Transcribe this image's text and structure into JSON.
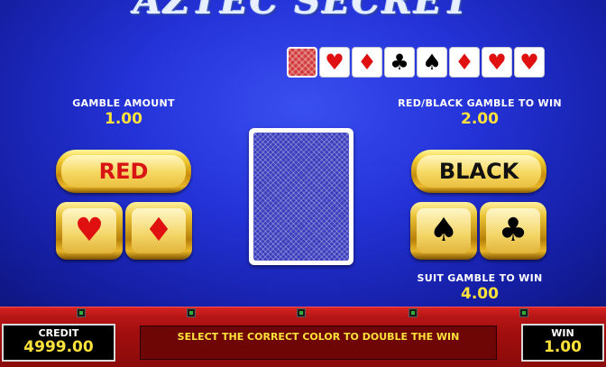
{
  "logo_text": "AZTEC SECRET",
  "history": [
    {
      "type": "back",
      "suit": ""
    },
    {
      "type": "red",
      "suit": "♥"
    },
    {
      "type": "red",
      "suit": "♦"
    },
    {
      "type": "black",
      "suit": "♣"
    },
    {
      "type": "black",
      "suit": "♠"
    },
    {
      "type": "red",
      "suit": "♦"
    },
    {
      "type": "red",
      "suit": "♥"
    },
    {
      "type": "red",
      "suit": "♥"
    }
  ],
  "gamble": {
    "label": "GAMBLE AMOUNT",
    "value": "1.00"
  },
  "color_gamble": {
    "label": "RED/BLACK GAMBLE TO WIN",
    "value": "2.00"
  },
  "suit_gamble": {
    "label": "SUIT GAMBLE TO WIN",
    "value": "4.00"
  },
  "buttons": {
    "red": "RED",
    "black": "BLACK",
    "hearts": "♥",
    "diamonds": "♦",
    "spades": "♠",
    "clubs": "♣"
  },
  "panel": {
    "credit_label": "CREDIT",
    "credit_value": "4999.00",
    "win_label": "WIN",
    "win_value": "1.00",
    "message": "SELECT THE CORRECT COLOR TO DOUBLE THE WIN"
  },
  "colors": {
    "red_suit": "#e01010",
    "gold": "#f2cf35",
    "value_yellow": "#ffe23a"
  }
}
